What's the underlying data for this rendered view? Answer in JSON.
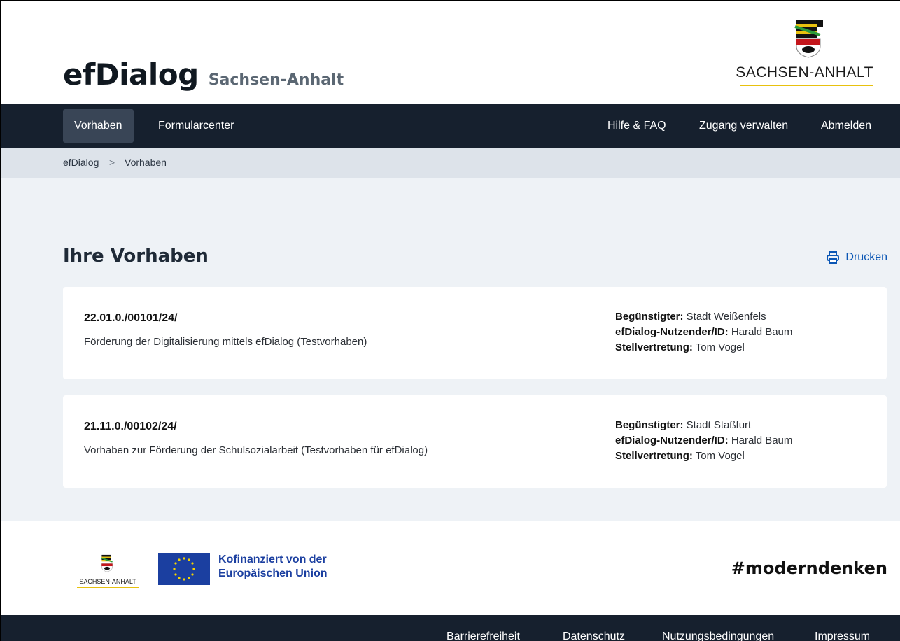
{
  "header": {
    "title": "efDialog",
    "subtitle": "Sachsen-Anhalt",
    "state_logo_text": "SACHSEN-ANHALT"
  },
  "nav": {
    "left": [
      {
        "label": "Vorhaben",
        "active": true
      },
      {
        "label": "Formularcenter",
        "active": false
      }
    ],
    "right": [
      {
        "label": "Hilfe & FAQ"
      },
      {
        "label": "Zugang verwalten"
      },
      {
        "label": "Abmelden"
      }
    ]
  },
  "breadcrumb": {
    "items": [
      "efDialog",
      "Vorhaben"
    ],
    "separator": ">"
  },
  "main": {
    "title": "Ihre Vorhaben",
    "print_label": "Drucken",
    "projects": [
      {
        "number": "22.01.0./00101/24/",
        "description": "Förderung der Digitalisierung mittels efDialog (Testvorhaben)",
        "beneficiary_label": "Begünstigter:",
        "beneficiary": "Stadt Weißenfels",
        "user_label": "efDialog-Nutzender/ID:",
        "user": "Harald Baum",
        "deputy_label": "Stellvertretung:",
        "deputy": "Tom Vogel"
      },
      {
        "number": "21.11.0./00102/24/",
        "description": "Vorhaben zur Förderung der Schulsozialarbeit (Testvorhaben für efDialog)",
        "beneficiary_label": "Begünstigter:",
        "beneficiary": "Stadt Staßfurt",
        "user_label": "efDialog-Nutzender/ID:",
        "user": "Harald Baum",
        "deputy_label": "Stellvertretung:",
        "deputy": "Tom Vogel"
      }
    ]
  },
  "footer": {
    "state_logo_text": "SACHSEN-ANHALT",
    "eu_line1": "Kofinanziert von der",
    "eu_line2": "Europäischen Union",
    "hashtag": "#moderndenken",
    "links": [
      "Barrierefreiheit",
      "Datenschutz",
      "Nutzungsbedingungen",
      "Impressum"
    ]
  },
  "colors": {
    "nav_bg": "#16202e",
    "nav_active": "#394556",
    "breadcrumb_bg": "#dde3ea",
    "page_bg": "#eef2f6",
    "link_blue": "#0b57b5",
    "eu_blue": "#1b3fa0",
    "accent_yellow": "#e8c10e"
  }
}
